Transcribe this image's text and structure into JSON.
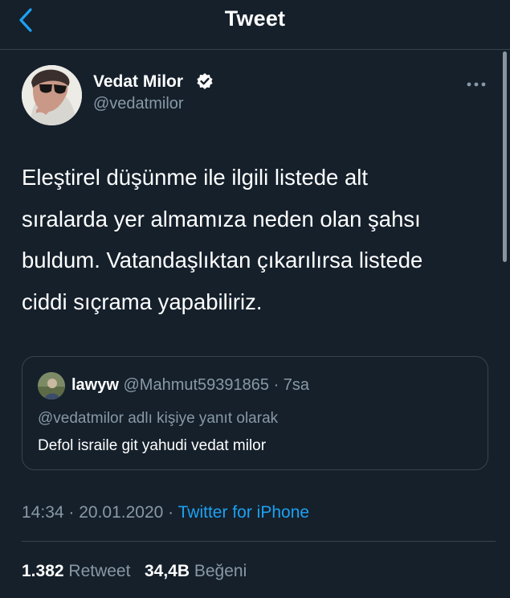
{
  "header": {
    "title": "Tweet",
    "back_icon": "chevron-left-icon"
  },
  "author": {
    "display_name": "Vedat Milor",
    "handle": "@vedatmilor",
    "verified_icon": "verified-badge-icon"
  },
  "tweet": {
    "lines": [
      "Eleştirel düşünme ile ilgili listede alt",
      "sıralarda yer almamıza neden olan şahsı",
      "buldum. Vatandaşlıktan çıkarılırsa listede",
      "ciddi sıçrama yapabiliriz."
    ]
  },
  "quoted": {
    "name": "lawyw",
    "handle": "@Mahmut59391865",
    "time": "· 7sa",
    "reply_to": "@vedatmilor adlı kişiye yanıt olarak",
    "text": "Defol israile git yahudi vedat milor"
  },
  "meta": {
    "time": "14:34",
    "sep1": " · ",
    "date": "20.01.2020",
    "sep2": " · ",
    "source": "Twitter for iPhone"
  },
  "stats": {
    "retweets": "1.382",
    "retweets_label": "Retweet",
    "likes": "34,4B",
    "likes_label": "Beğeni"
  },
  "colors": {
    "background": "#15202b",
    "accent": "#1da1f2",
    "secondary_text": "#8899a6",
    "border": "#38444d"
  }
}
